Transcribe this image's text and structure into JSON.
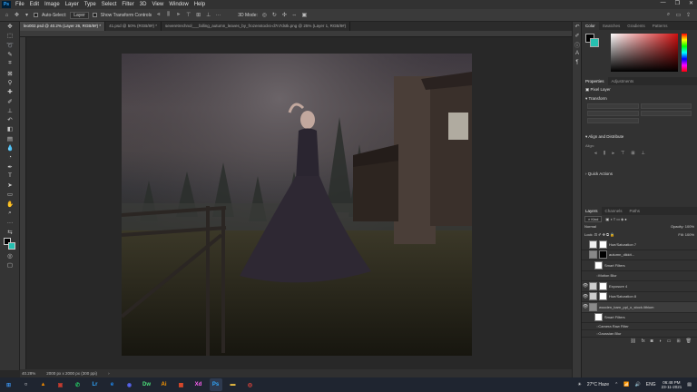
{
  "menu": {
    "items": [
      "File",
      "Edit",
      "Image",
      "Layer",
      "Type",
      "Select",
      "Filter",
      "3D",
      "View",
      "Window",
      "Help"
    ],
    "app_logo": "Ps"
  },
  "window_controls": {
    "minimize": "—",
    "restore": "❐",
    "close": "✕"
  },
  "options_bar": {
    "auto_select_label": "Auto-Select:",
    "auto_select_value": "Layer",
    "show_transform_label": "Show Transform Controls",
    "mode_label": "3D Mode:"
  },
  "doc_tabs": [
    {
      "label": "leo002.psd @ 40.2% (Layer 26, RGB/8#) *",
      "active": true
    },
    {
      "label": "41.psd @ 50% (RGB/8#) *",
      "active": false
    },
    {
      "label": "severetrechnol___falling_autumn_leaves_by_frozenstocks-d7n7dstk.png @ 25% (Layer 1, RGB/8#)",
      "active": false
    }
  ],
  "status_bar": {
    "zoom": "40.28%",
    "doc_size": "2000 px x 2000 px (300 ppi)"
  },
  "color_panel": {
    "tabs": [
      "Color",
      "Swatches",
      "Gradients",
      "Patterns"
    ],
    "foreground": "#000000",
    "background": "#26c0b0",
    "hue_color": "#d01010"
  },
  "properties_panel": {
    "tabs": [
      "Properties",
      "Adjustments"
    ],
    "layer_type": "Pixel Layer",
    "transform_label": "Transform",
    "align_label": "Align and Distribute",
    "align_sub": "Align:",
    "quick_actions_label": "Quick Actions"
  },
  "layers_panel": {
    "tabs": [
      "Layers",
      "Channels",
      "Paths"
    ],
    "filter_kind": "Kind",
    "blend_mode": "Normal",
    "opacity_label": "Opacity:",
    "opacity_value": "100%",
    "lock_label": "Lock:",
    "fill_label": "Fill:",
    "fill_value": "100%",
    "layers": [
      {
        "name": "Hue/Saturation 7",
        "visible": false,
        "kind": "adj"
      },
      {
        "name": "autumn_dikkit...",
        "visible": false,
        "kind": "smart"
      },
      {
        "name": "Smart Filters",
        "visible": false,
        "kind": "filters"
      },
      {
        "name": "Motion Blur",
        "visible": false,
        "kind": "filter"
      },
      {
        "name": "Exposure 4",
        "visible": true,
        "kind": "adj"
      },
      {
        "name": "Hue/Saturation 8",
        "visible": true,
        "kind": "adj"
      },
      {
        "name": "wooden_barn_ppl_o_stock.lithium",
        "visible": true,
        "kind": "smart"
      },
      {
        "name": "Smart Filters",
        "visible": true,
        "kind": "filters"
      },
      {
        "name": "Camera Raw Filter",
        "visible": true,
        "kind": "filter"
      },
      {
        "name": "Gaussian Blur",
        "visible": true,
        "kind": "filter"
      }
    ]
  },
  "taskbar": {
    "apps": [
      {
        "name": "start",
        "glyph": "⊞",
        "color": "#3a8ee6"
      },
      {
        "name": "search",
        "glyph": "○",
        "color": "#ffffff"
      },
      {
        "name": "vlc",
        "glyph": "▲",
        "color": "#f08a00"
      },
      {
        "name": "photos",
        "glyph": "▣",
        "color": "#c23b2f"
      },
      {
        "name": "whatsapp",
        "glyph": "✆",
        "color": "#25d366"
      },
      {
        "name": "lightroom",
        "glyph": "Lr",
        "color": "#31a8ff"
      },
      {
        "name": "explorer-ie",
        "glyph": "e",
        "color": "#1e90ff"
      },
      {
        "name": "discord",
        "glyph": "◉",
        "color": "#5865f2"
      },
      {
        "name": "dreamweaver",
        "glyph": "Dw",
        "color": "#4ce07a"
      },
      {
        "name": "illustrator",
        "glyph": "Ai",
        "color": "#ff9a00"
      },
      {
        "name": "office",
        "glyph": "▦",
        "color": "#e24a2a"
      },
      {
        "name": "xd",
        "glyph": "Xd",
        "color": "#ff61f6"
      },
      {
        "name": "photoshop",
        "glyph": "Ps",
        "color": "#31a8ff"
      },
      {
        "name": "file-explorer",
        "glyph": "▬",
        "color": "#f4c542"
      },
      {
        "name": "chrome",
        "glyph": "◎",
        "color": "#e8453c"
      }
    ],
    "weather": "27°C  Haze",
    "language": "ENG",
    "time": "06:48 PM",
    "date": "23-11-2021"
  }
}
